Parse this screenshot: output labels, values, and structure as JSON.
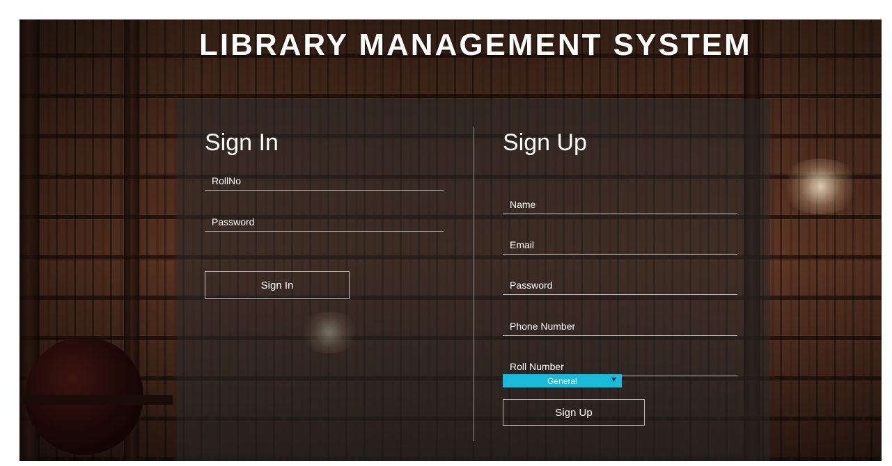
{
  "app": {
    "title": "LIBRARY MANAGEMENT SYSTEM"
  },
  "signin": {
    "heading": "Sign In",
    "rollno_placeholder": "RollNo",
    "password_placeholder": "Password",
    "button_label": "Sign In"
  },
  "signup": {
    "heading": "Sign Up",
    "name_placeholder": "Name",
    "email_placeholder": "Email",
    "password_placeholder": "Password",
    "phone_placeholder": "Phone Number",
    "roll_placeholder": "Roll Number",
    "category_selected": "General",
    "button_label": "Sign Up"
  },
  "colors": {
    "select_bg": "#18bcd8",
    "text": "#ffffff"
  },
  "icons": {
    "select_arrow": "chevron-down-icon"
  }
}
